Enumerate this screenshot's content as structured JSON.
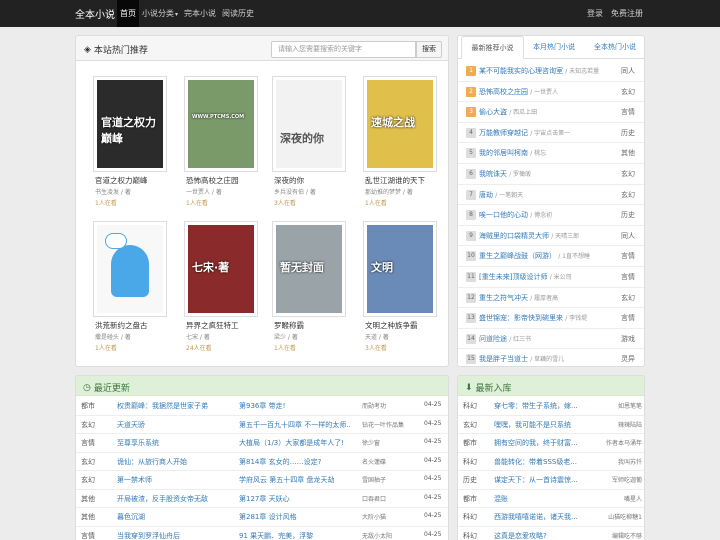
{
  "nav": {
    "brand": "全本小说",
    "items": [
      "首页",
      "小说分类",
      "完本小说",
      "阅读历史"
    ],
    "login": "登录",
    "register": "免费注册"
  },
  "hot": {
    "title": "本站热门推荐",
    "search_placeholder": "请输入您需要搜索的关键字",
    "search_button": "搜索",
    "books": [
      {
        "title": "官道之权力巅峰",
        "author": "书生凌发 / 著",
        "reading": "1人在看",
        "cover_text": "官道之权力巅峰",
        "bg": "#2b2b2b"
      },
      {
        "title": "恐怖高校之庄园",
        "author": "一世贾人 / 著",
        "reading": "1人在看",
        "cover_text": "WWW.PTCMS.COM",
        "bg": "#7a9a6a"
      },
      {
        "title": "深夜的你",
        "author": "乡兵没有伯 / 著",
        "reading": "3人在看",
        "cover_text": "深夜的你",
        "bg": "#f2f2f2"
      },
      {
        "title": "乱世江湖谁的天下",
        "author": "那幼推的梦梦 / 著",
        "reading": "1人在看",
        "cover_text": "速城之战",
        "bg": "#e0c04a"
      },
      {
        "title": "洪荒新约之盘古",
        "author": "撒是碰头 / 著",
        "reading": "1人在看",
        "cover_text": "",
        "bg": "#f8f8f8"
      },
      {
        "title": "异界之疯狂特工",
        "author": "七宋 / 著",
        "reading": "24人在看",
        "cover_text": "七宋·著",
        "bg": "#8a2a2a"
      },
      {
        "title": "罗睺称霸",
        "author": "梁少 / 著",
        "reading": "1人在看",
        "cover_text": "暂无封面",
        "bg": "#9aa4a8"
      },
      {
        "title": "文明之种族争霸",
        "author": "天道 / 著",
        "reading": "3人在看",
        "cover_text": "文明",
        "bg": "#6a8ab8"
      }
    ]
  },
  "rank": {
    "tabs": [
      "最新推荐小说",
      "本月热门小说",
      "全本热门小说"
    ],
    "items": [
      {
        "num": "1",
        "title": "某不可能我实的心理咨询室",
        "author": "未知志若量",
        "cat": "同人"
      },
      {
        "num": "2",
        "title": "恐怖高校之庄园",
        "author": "一世贾人",
        "cat": "玄幻"
      },
      {
        "num": "3",
        "title": "偷心大盗",
        "author": "西瓜上田",
        "cat": "言情"
      },
      {
        "num": "4",
        "title": "万能教师穿越记",
        "author": "宇宙点击第一",
        "cat": "历史"
      },
      {
        "num": "5",
        "title": "我的邻居叫柯南",
        "author": "桃忘",
        "cat": "其他"
      },
      {
        "num": "6",
        "title": "我皖诛天",
        "author": "罗橄皈",
        "cat": "玄幻"
      },
      {
        "num": "7",
        "title": "唐劫",
        "author": "一笔朝天",
        "cat": "玄幻"
      },
      {
        "num": "8",
        "title": "唉一口他的心动",
        "author": "傅念初",
        "cat": "历史"
      },
      {
        "num": "9",
        "title": "海贼里的口袋精灵大师",
        "author": "天晴三郎",
        "cat": "同人"
      },
      {
        "num": "10",
        "title": "重生之巅峰战鼓（网游）",
        "author": "1直不想睡",
        "cat": "言情"
      },
      {
        "num": "11",
        "title": "[重生未来]顶级设计师",
        "author": "米公司",
        "cat": "言情"
      },
      {
        "num": "12",
        "title": "重生之符气冲天",
        "author": "履厚者高",
        "cat": "玄幻"
      },
      {
        "num": "13",
        "title": "盛世锦宠：影帝快到碗里来",
        "author": "李钱堤",
        "cat": "言情"
      },
      {
        "num": "14",
        "title": "问道险途",
        "author": "红三书",
        "cat": "游戏"
      },
      {
        "num": "15",
        "title": "我是胖子当道士",
        "author": "草藕的雪儿",
        "cat": "灵异"
      }
    ]
  },
  "latest": {
    "title": "最近更新",
    "rows": [
      {
        "cat": "都市",
        "book": "权贵巅峰：我据然是世家子弟",
        "chapter": "第936章 带走!",
        "author": "而勋考功",
        "date": "04-25"
      },
      {
        "cat": "玄幻",
        "book": "天道天骄",
        "chapter": "第五千一百九十四章 不一样的太师...",
        "author": "钻花一叶作品集",
        "date": "04-25"
      },
      {
        "cat": "言情",
        "book": "至尊享乐系统",
        "chapter": "大植局（1/3）大家都是成年人了!",
        "author": "徐少窗",
        "date": "04-25"
      },
      {
        "cat": "玄幻",
        "book": "诡仙：从旅行商人开始",
        "chapter": "第814章 玄女的……设定?",
        "author": "名火蓮碟",
        "date": "04-25"
      },
      {
        "cat": "玄幻",
        "book": "第一禁术师",
        "chapter": "学府风云 第五十四章 盘龙天劫",
        "author": "雪国柚子",
        "date": "04-25"
      },
      {
        "cat": "其他",
        "book": "开局被渣，反手股资女帝无敌",
        "chapter": "第127章 天妖心",
        "author": "口吞君口",
        "date": "04-25"
      },
      {
        "cat": "其他",
        "book": "暮色沉湖",
        "chapter": "第281章 设计风格",
        "author": "大阶小猫",
        "date": "04-25"
      },
      {
        "cat": "言情",
        "book": "当我穿到罗浮仙舟后",
        "chapter": "91 果天鹏、完美，浮黎",
        "author": "无敌小太阳",
        "date": "04-25"
      }
    ]
  },
  "newbooks": {
    "title": "最新入库",
    "rows": [
      {
        "cat": "科幻",
        "book": "穿七零：带生子系统，嫁...",
        "author": "如恩笔笔"
      },
      {
        "cat": "玄幻",
        "book": "嘿嘿，我可能不是只系统",
        "author": "辣辣陆陆"
      },
      {
        "cat": "都市",
        "book": "拥有空间的我，终于财富...",
        "author": "作者本马涌年"
      },
      {
        "cat": "科幻",
        "book": "兽能转化：带着SSS级老...",
        "author": "我叫苏忏"
      },
      {
        "cat": "历史",
        "book": "谋定天下：从一首诗震惊...",
        "author": "军师吃迦葡"
      },
      {
        "cat": "都市",
        "book": "混账",
        "author": "嘴星人"
      },
      {
        "cat": "科幻",
        "book": "西游我嘻嘻诺诺，诸天我...",
        "author": "山猫吃柳糖1"
      },
      {
        "cat": "科幻",
        "book": "这真是恋爱攻略?",
        "author": "编辑吃不够"
      }
    ]
  }
}
